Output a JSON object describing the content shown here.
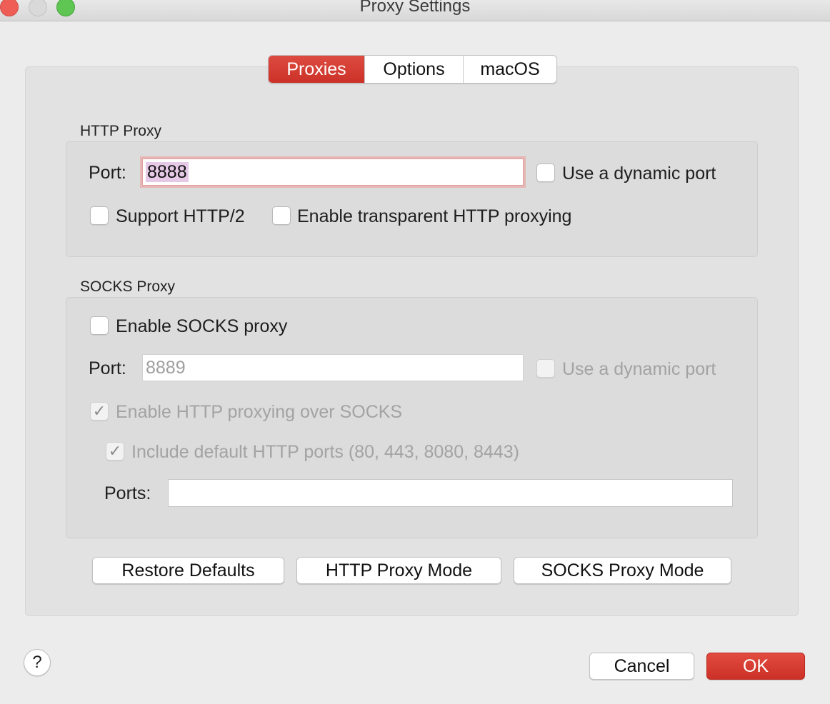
{
  "window": {
    "title": "Proxy Settings"
  },
  "tabs": [
    {
      "label": "Proxies",
      "active": true
    },
    {
      "label": "Options",
      "active": false
    },
    {
      "label": "macOS",
      "active": false
    }
  ],
  "http_proxy": {
    "group_label": "HTTP Proxy",
    "port_label": "Port:",
    "port_value": "8888",
    "dynamic_port_label": "Use a dynamic port",
    "dynamic_port_checked": false,
    "http2_label": "Support HTTP/2",
    "http2_checked": false,
    "transparent_label": "Enable transparent HTTP proxying",
    "transparent_checked": false
  },
  "socks_proxy": {
    "group_label": "SOCKS Proxy",
    "enable_label": "Enable SOCKS proxy",
    "enable_checked": false,
    "port_label": "Port:",
    "port_placeholder": "8889",
    "dynamic_port_label": "Use a dynamic port",
    "http_over_socks_label": "Enable HTTP proxying over SOCKS",
    "http_over_socks_checked": true,
    "include_ports_label": "Include default HTTP ports (80, 443, 8080, 8443)",
    "include_ports_checked": true,
    "ports_label": "Ports:",
    "ports_value": ""
  },
  "actions": {
    "restore_defaults": "Restore Defaults",
    "http_proxy_mode": "HTTP Proxy Mode",
    "socks_proxy_mode": "SOCKS Proxy Mode"
  },
  "footer": {
    "help": "?",
    "cancel": "Cancel",
    "ok": "OK"
  },
  "colors": {
    "accent": "#d13a30",
    "window_bg": "#ececec",
    "group_bg": "#dcdcdc",
    "disabled_text": "#a3a3a3"
  },
  "check_glyph": "✓"
}
